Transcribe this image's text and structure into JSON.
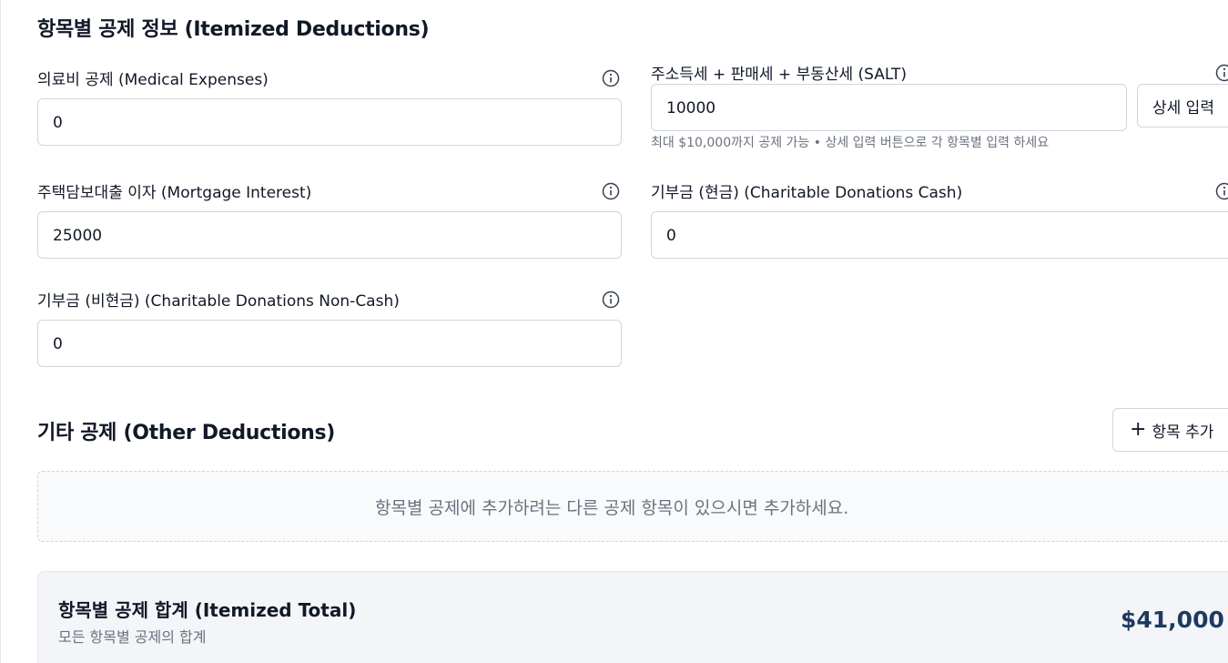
{
  "itemized": {
    "title": "항목별 공제 정보 (Itemized Deductions)",
    "medical": {
      "label": "의료비 공제 (Medical Expenses)",
      "value": "0"
    },
    "salt": {
      "label": "주소득세 + 판매세 + 부동산세 (SALT)",
      "value": "10000",
      "detail_button": "상세 입력",
      "helper": "최대 $10,000까지 공제 가능 • 상세 입력 버튼으로 각 항목별 입력 하세요"
    },
    "mortgage": {
      "label": "주택담보대출 이자 (Mortgage Interest)",
      "value": "25000"
    },
    "donations_cash": {
      "label": "기부금 (현금) (Charitable Donations Cash)",
      "value": "0"
    },
    "donations_noncash": {
      "label": "기부금 (비현금) (Charitable Donations Non-Cash)",
      "value": "0"
    }
  },
  "other": {
    "title": "기타 공제 (Other Deductions)",
    "add_button": "항목 추가",
    "add_icon": "+",
    "empty_message": "항목별 공제에 추가하려는 다른 공제 항목이 있으시면 추가하세요."
  },
  "total": {
    "title": "항목별 공제 합계 (Itemized Total)",
    "subtitle": "모든 항목별 공제의 합계",
    "amount": "$41,000"
  },
  "colors": {
    "total_amount": "#1e3a5f",
    "border": "#d1d5db",
    "muted_text": "#6b7280"
  }
}
